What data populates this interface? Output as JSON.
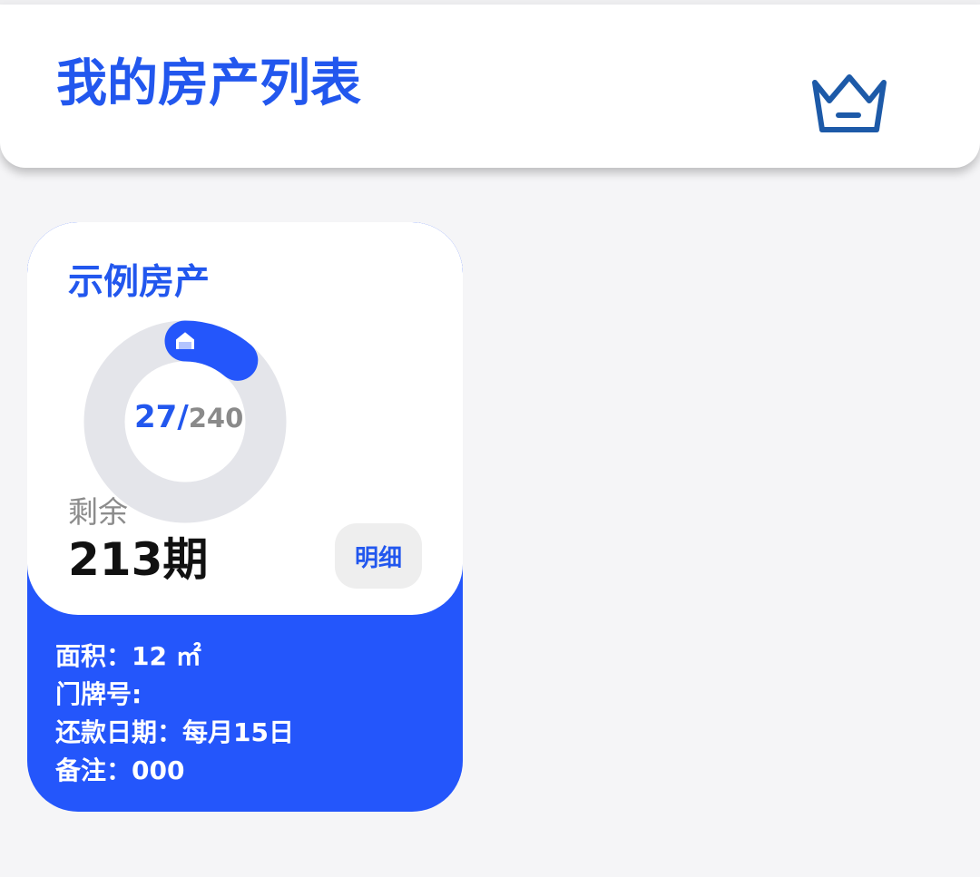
{
  "header": {
    "title": "我的房产列表",
    "vip_icon": "crown-icon"
  },
  "colors": {
    "brand_blue": "#2257ee",
    "card_blue": "#2456fb",
    "ring_track": "#e4e5ea",
    "crown_blue": "#1d5aa8"
  },
  "property": {
    "name": "示例房产",
    "progress": {
      "paid": "27/",
      "total": "240",
      "fraction": 0.1125,
      "marker_icon": "home-icon"
    },
    "remaining_label": "剩余",
    "remaining_value": "213期",
    "detail_button": "明细",
    "info": {
      "area": "面积：12 ㎡",
      "house_number": "门牌号:",
      "repayment_date": "还款日期：每月15日",
      "note": "备注：000"
    }
  }
}
